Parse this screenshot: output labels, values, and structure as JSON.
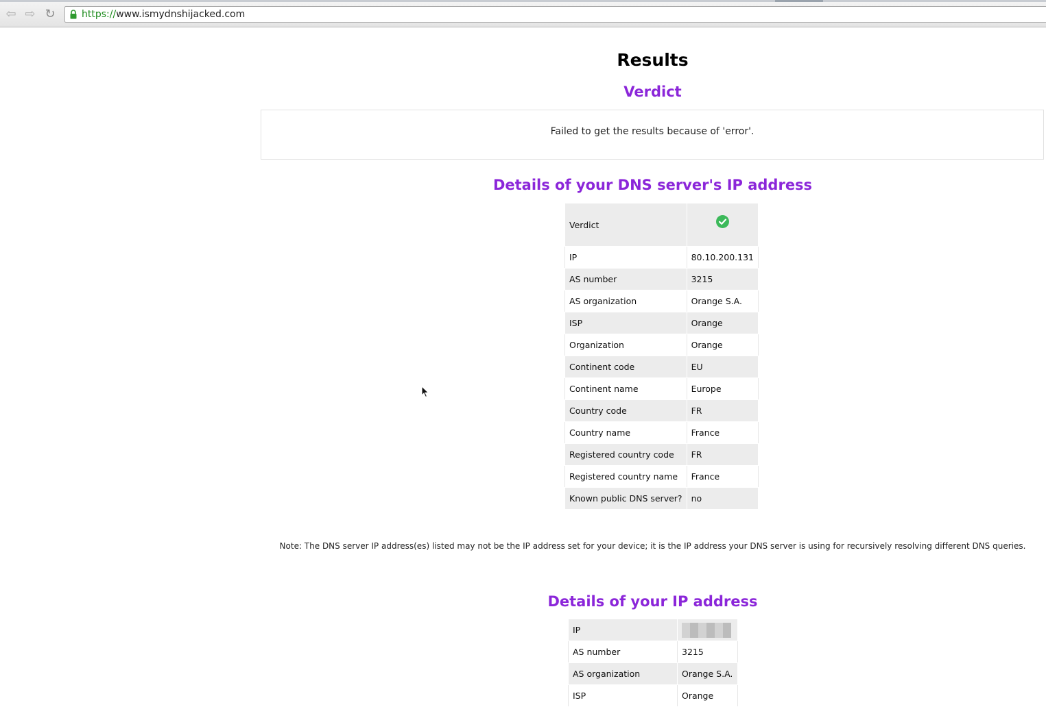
{
  "browser": {
    "url_scheme": "https://",
    "url_host": "www.ismydnshijacked.com",
    "back_icon": "back-arrow-icon",
    "forward_icon": "forward-arrow-icon",
    "reload_icon": "reload-icon",
    "lock_icon": "lock-icon"
  },
  "page": {
    "title": "Results",
    "verdict_heading": "Verdict",
    "verdict_message": "Failed to get the results because of 'error'.",
    "dns_heading": "Details of your DNS server's IP address",
    "dns_table": {
      "verdict_label": "Verdict",
      "verdict_icon": "check-circle-icon",
      "verdict_color": "#3cb95a",
      "rows": [
        {
          "key": "IP",
          "value": "80.10.200.131"
        },
        {
          "key": "AS number",
          "value": "3215"
        },
        {
          "key": "AS organization",
          "value": "Orange S.A."
        },
        {
          "key": "ISP",
          "value": "Orange"
        },
        {
          "key": "Organization",
          "value": "Orange"
        },
        {
          "key": "Continent code",
          "value": "EU"
        },
        {
          "key": "Continent name",
          "value": "Europe"
        },
        {
          "key": "Country code",
          "value": "FR"
        },
        {
          "key": "Country name",
          "value": "France"
        },
        {
          "key": "Registered country code",
          "value": "FR"
        },
        {
          "key": "Registered country name",
          "value": "France"
        },
        {
          "key": "Known public DNS server?",
          "value": "no"
        }
      ]
    },
    "note": "Note: The DNS server IP address(es) listed may not be the IP address set for your device; it is the IP address your DNS server is using for recursively resolving different DNS queries.",
    "ip_heading": "Details of your IP address",
    "ip_table": {
      "rows": [
        {
          "key": "IP",
          "value": ""
        },
        {
          "key": "AS number",
          "value": "3215"
        },
        {
          "key": "AS organization",
          "value": "Orange S.A."
        },
        {
          "key": "ISP",
          "value": "Orange"
        }
      ]
    }
  },
  "colors": {
    "heading_purple": "#8b26d9",
    "row_shade": "#ececec",
    "url_scheme_green": "#1a8a1a"
  }
}
